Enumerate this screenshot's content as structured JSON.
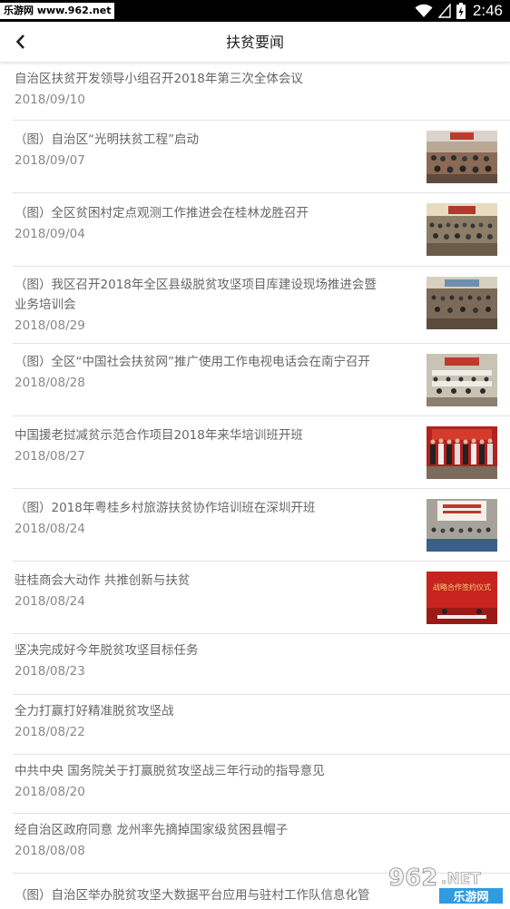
{
  "status_bar": {
    "watermark": "乐游网 www.962.net",
    "time": "2:46"
  },
  "header": {
    "title": "扶贫要闻"
  },
  "news": [
    {
      "title": "自治区扶贫开发领导小组召开2018年第三次全体会议",
      "date": "2018/09/10"
    },
    {
      "title": "（图）自治区“光明扶贫工程”启动",
      "date": "2018/09/07"
    },
    {
      "title": "（图）全区贫困村定点观测工作推进会在桂林龙胜召开",
      "date": "2018/09/04"
    },
    {
      "title": "（图）我区召开2018年全区县级脱贫攻坚项目库建设现场推进会暨",
      "title2": "业务培训会",
      "date": "2018/08/29"
    },
    {
      "title": "（图）全区“中国社会扶贫网”推广使用工作电视电话会在南宁召开",
      "date": "2018/08/28"
    },
    {
      "title": "中国援老挝减贫示范合作项目2018年来华培训班开班",
      "date": "2018/08/27"
    },
    {
      "title": "（图）2018年粤桂乡村旅游扶贫协作培训班在深圳开班",
      "date": "2018/08/24"
    },
    {
      "title": "驻桂商会大动作 共推创新与扶贫",
      "date": "2018/08/24"
    },
    {
      "title": "坚决完成好今年脱贫攻坚目标任务",
      "date": "2018/08/23"
    },
    {
      "title": "全力打赢打好精准脱贫攻坚战",
      "date": "2018/08/22"
    },
    {
      "title": "中共中央 国务院关于打赢脱贫攻坚战三年行动的指导意见",
      "date": "2018/08/20"
    },
    {
      "title": "经自治区政府同意 龙州率先摘掉国家级贫困县帽子",
      "date": "2018/08/08"
    },
    {
      "title": "（图）自治区举办脱贫攻坚大数据平台应用与驻村工作队信息化管",
      "date": ""
    }
  ],
  "thumb_banner_text": "战略合作签约仪式",
  "footer_watermark": {
    "number": "962",
    "suffix": ".NET",
    "brand": "乐游网"
  }
}
